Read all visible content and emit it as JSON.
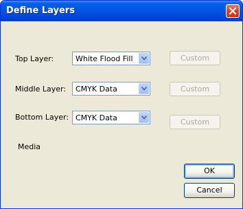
{
  "window": {
    "title": "Define Layers"
  },
  "layers": [
    {
      "label": "Top Layer:",
      "value": "White Flood Fill",
      "custom_label": "Custom"
    },
    {
      "label": "Middle Layer:",
      "value": "CMYK Data",
      "custom_label": "Custom"
    },
    {
      "label": "Bottom Layer:",
      "value": "CMYK Data",
      "custom_label": "Custom"
    }
  ],
  "media_label": "Media",
  "buttons": {
    "ok": "OK",
    "cancel": "Cancel"
  },
  "colors": {
    "titlebar": "#0055e5",
    "close": "#d8452b",
    "dialog_bg": "#ece9d8"
  }
}
